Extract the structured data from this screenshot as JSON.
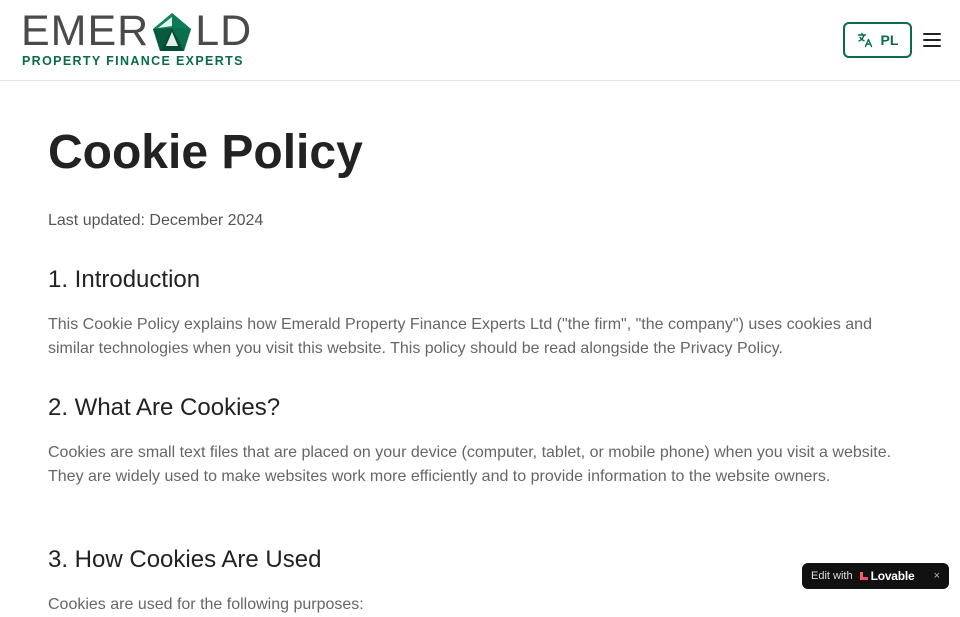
{
  "header": {
    "logo": {
      "word_left": "EMER",
      "word_right": "LD",
      "tagline": "PROPERTY FINANCE EXPERTS"
    },
    "language_button": {
      "label": "PL",
      "icon": "translate-icon"
    },
    "menu_icon": "hamburger-menu-icon"
  },
  "page": {
    "title": "Cookie Policy",
    "last_updated": "Last updated: December 2024",
    "sections": [
      {
        "heading": "1. Introduction",
        "body": "This Cookie Policy explains how Emerald Property Finance Experts Ltd (\"the firm\", \"the company\") uses cookies and similar technologies when you visit this website. This policy should be read alongside the Privacy Policy."
      },
      {
        "heading": "2. What Are Cookies?",
        "body": "Cookies are small text files that are placed on your device (computer, tablet, or mobile phone) when you visit a website. They are widely used to make websites work more efficiently and to provide information to the website owners."
      },
      {
        "heading": "3. How Cookies Are Used",
        "body": "Cookies are used for the following purposes:"
      }
    ]
  },
  "badge": {
    "edit_with": "Edit with",
    "brand": "Lovable",
    "close": "×"
  },
  "colors": {
    "brand_green": "#0a6b4a",
    "heading": "#222222",
    "body_text": "#666666"
  }
}
